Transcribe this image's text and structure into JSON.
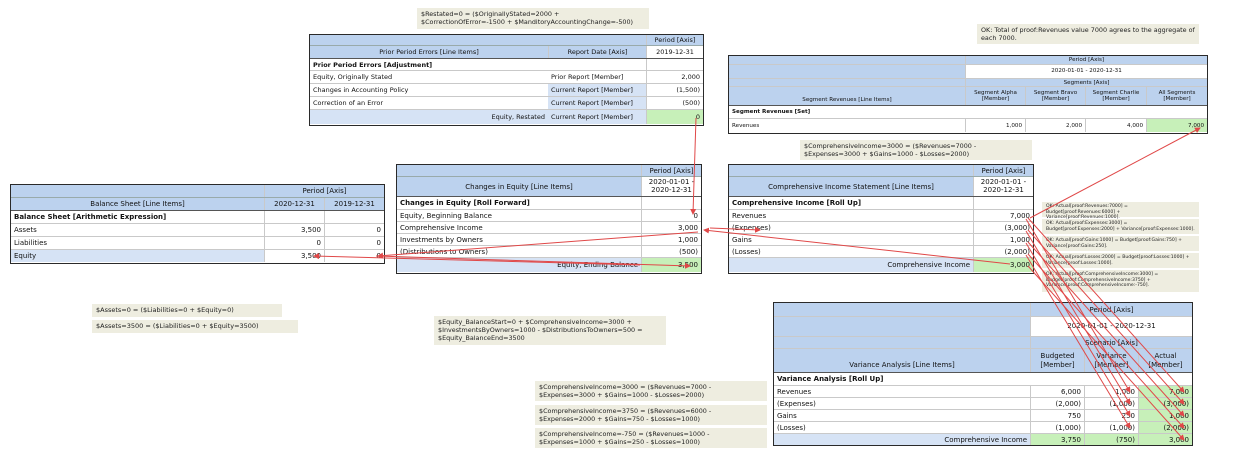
{
  "prior": {
    "period_header": "Period [Axis]",
    "col1": "Prior Period Errors [Line Items]",
    "col2": "Report Date [Axis]",
    "col3": "2019-12-31",
    "section": "Prior Period Errors [Adjustment]",
    "rows": [
      {
        "label": "Equity, Originally Stated",
        "member": "Prior Report [Member]",
        "value": "2,000"
      },
      {
        "label": "Changes in Accounting Policy",
        "member": "Current Report [Member]",
        "value": "(1,500)"
      },
      {
        "label": "Correction of an Error",
        "member": "Current Report [Member]",
        "value": "(500)"
      },
      {
        "label": "Equity, Restated",
        "member": "Current Report [Member]",
        "value": "0"
      }
    ]
  },
  "notes": {
    "restated": "$Restated=0 = ($OriginallyStated=2000 + $CorrectionOfError=-1500 + $ManditoryAccountingChange=-500)",
    "ok_revenues": "OK: Total of proof:Revenues value 7000 agrees to the aggregate of each 7000.",
    "ci_top": "$ComprehensiveIncome=3000 = ($Revenues=7000 - $Expenses=3000 + $Gains=1000 - $Losses=2000)",
    "assets0": "$Assets=0 = ($Liabilities=0 + $Equity=0)",
    "assets3500": "$Assets=3500 = ($Liabilities=0 + $Equity=3500)",
    "equity_balance": "$Equity_BalanceStart=0 + $ComprehensiveIncome=3000 + $InvestmentsByOwners=1000 - $DistributionsToOwners=500 = $Equity_BalanceEnd=3500",
    "ci_a": "$ComprehensiveIncome=3000 = ($Revenues=7000 - $Expenses=3000 + $Gains=1000 - $Losses=2000)",
    "ci_b": "$ComprehensiveIncome=3750 = ($Revenues=6000 - $Expenses=2000 + $Gains=750 - $Losses=1000)",
    "ci_c": "$ComprehensiveIncome=-750 = ($Revenues=1000 - $Expenses=1000 + $Gains=250 - $Losses=1000)",
    "small1": "OK: Actual[proof:Revenues:7000] = Budget[proof:Revenues:6000] + Variance[proof:Revenues:1000].",
    "small2": "OK: Actual[proof:Expenses:3000] = Budget[proof:Expenses:2000] + Variance[proof:Expenses:1000].",
    "small3": "OK: Actual[proof:Gains:1000] = Budget[proof:Gains:750] + Variance[proof:Gains:250].",
    "small4": "OK: Actual[proof:Losses:2000] = Budget[proof:Losses:1000] + Variance[proof:Losses:1000].",
    "small5": "OK: Actual[proof:ComprehensiveIncome:3000] = Budget[proof:ComprehensiveIncome:3750] + Variance[proof:ComprehensiveIncome:-750]."
  },
  "segment": {
    "period_header": "Period [Axis]",
    "period_value": "2020-01-01 - 2020-12-31",
    "segments_header": "Segments [Axis]",
    "line_items": "Segment Revenues [Line Items]",
    "members": [
      "Segment Alpha [Member]",
      "Segment Bravo [Member]",
      "Segment Charlie [Member]",
      "All Segments [Member]"
    ],
    "section": "Segment Revenues [Set]",
    "row_label": "Revenues",
    "values": [
      "1,000",
      "2,000",
      "4,000",
      "7,000"
    ]
  },
  "balance": {
    "period_header": "Period [Axis]",
    "line_items": "Balance Sheet [Line Items]",
    "col1": "2020-12-31",
    "col2": "2019-12-31",
    "section": "Balance Sheet [Arithmetic Expression]",
    "rows": [
      {
        "label": "Assets",
        "v1": "3,500",
        "v2": "0"
      },
      {
        "label": "Liabilities",
        "v1": "0",
        "v2": "0"
      },
      {
        "label": "Equity",
        "v1": "3,500",
        "v2": "0"
      }
    ]
  },
  "equity": {
    "period_header": "Period [Axis]",
    "line_items": "Changes in Equity [Line Items]",
    "col": "2020-01-01 - 2020-12-31",
    "section": "Changes in Equity [Roll Forward]",
    "rows": [
      {
        "label": "Equity, Beginning Balance",
        "value": "0"
      },
      {
        "label": "Comprehensive Income",
        "value": "3,000"
      },
      {
        "label": "Investments by Owners",
        "value": "1,000"
      },
      {
        "label": "(Distributions to Owners)",
        "value": "(500)"
      },
      {
        "label": "Equity, Ending Balance",
        "value": "3,500"
      }
    ]
  },
  "comp": {
    "period_header": "Period [Axis]",
    "line_items": "Comprehensive Income Statement [Line Items]",
    "col": "2020-01-01 - 2020-12-31",
    "section": "Comprehensive Income [Roll Up]",
    "rows": [
      {
        "label": "Revenues",
        "value": "7,000"
      },
      {
        "label": "(Expenses)",
        "value": "(3,000)"
      },
      {
        "label": "Gains",
        "value": "1,000"
      },
      {
        "label": "(Losses)",
        "value": "(2,000)"
      },
      {
        "label": "Comprehensive Income",
        "value": "3,000"
      }
    ]
  },
  "variance": {
    "period_header": "Period [Axis]",
    "period_value": "2020-01-01 - 2020-12-31",
    "scenario_header": "Scenario [Axis]",
    "line_items": "Variance Analysis [Line Items]",
    "cols": [
      "Budgeted [Member]",
      "Variance [Member]",
      "Actual [Member]"
    ],
    "section": "Variance Analysis [Roll Up]",
    "rows": [
      {
        "label": "Revenues",
        "v": [
          "6,000",
          "1,000",
          "7,000"
        ]
      },
      {
        "label": "(Expenses)",
        "v": [
          "(2,000)",
          "(1,000)",
          "(3,000)"
        ]
      },
      {
        "label": "Gains",
        "v": [
          "750",
          "250",
          "1,000"
        ]
      },
      {
        "label": "(Losses)",
        "v": [
          "(1,000)",
          "(1,000)",
          "(2,000)"
        ]
      },
      {
        "label": "Comprehensive Income",
        "v": [
          "3,750",
          "(750)",
          "3,000"
        ]
      }
    ]
  },
  "colors": {
    "header": "#bcd2ee",
    "highlight": "#c7f0b9",
    "note_bg": "#eeede0",
    "arrow": "#e04848"
  }
}
